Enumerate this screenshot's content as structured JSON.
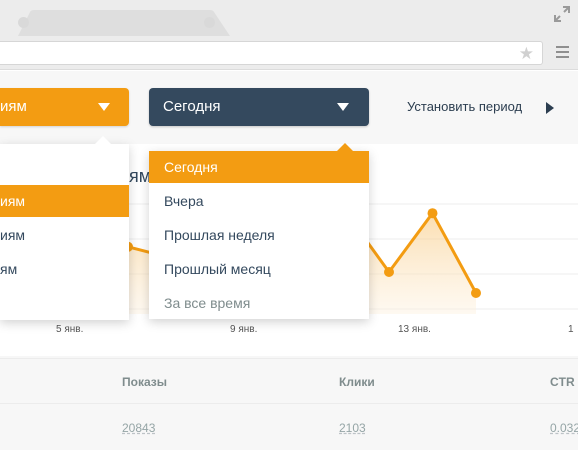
{
  "browser": {
    "colors": {
      "chrome": "#ececec",
      "accent": "#f39c12",
      "dark": "#34495e"
    }
  },
  "filters": {
    "grouping_select": {
      "value": "иям"
    },
    "period_select": {
      "value": "Сегодня"
    },
    "set_period_link": "Установить период"
  },
  "grouping_dropdown": {
    "items": [
      "иям",
      "иям",
      "ям"
    ],
    "active_index": 0
  },
  "period_dropdown": {
    "items": [
      "Сегодня",
      "Вчера",
      "Прошлая неделя",
      "Прошлый месяц",
      "За все время"
    ],
    "active_index": 0
  },
  "chart": {
    "heading_fragment": "ям"
  },
  "chart_data": {
    "type": "area",
    "x_tick_labels": [
      "5 янв.",
      "9 янв.",
      "13 янв.",
      "1"
    ],
    "series": [
      {
        "color": "#f39c12",
        "values": [
          125,
          136,
          148,
          140,
          162,
          167,
          130,
          173,
          130,
          172,
          115
        ]
      }
    ],
    "grid": true
  },
  "table": {
    "columns": [
      "Показы",
      "Клики",
      "CTR"
    ],
    "rows": [
      [
        "20843",
        "2103",
        "0.032"
      ]
    ]
  }
}
